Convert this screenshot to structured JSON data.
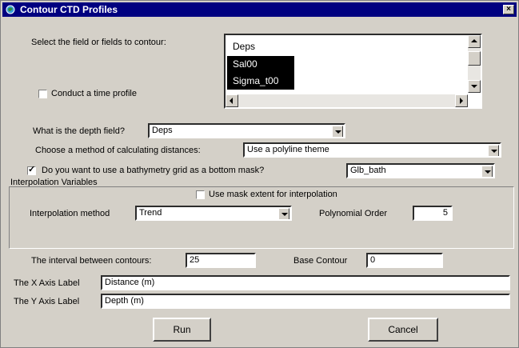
{
  "window": {
    "title": "Contour CTD Profiles",
    "close_label": "×"
  },
  "fields": {
    "label": "Select the field or fields to contour:",
    "items": [
      {
        "label": "Deps",
        "selected": false
      },
      {
        "label": "Sal00",
        "selected": true
      },
      {
        "label": "Sigma_t00",
        "selected": true
      }
    ]
  },
  "time_profile": {
    "label": "Conduct a time profile",
    "checked": false
  },
  "depth_field": {
    "label": "What is the depth field?",
    "value": "Deps"
  },
  "distance_method": {
    "label": "Choose a method of calculating distances:",
    "value": "Use a polyline theme"
  },
  "bathymetry": {
    "label": "Do you want to use a bathymetry grid as a bottom mask?",
    "checked": true,
    "value": "Glb_bath"
  },
  "interpolation": {
    "group_label": "Interpolation Variables",
    "mask_extent_label": "Use mask extent for interpolation",
    "mask_extent_checked": false,
    "method_label": "Interpolation method",
    "method_value": "Trend",
    "poly_label": "Polynomial Order",
    "poly_value": "5"
  },
  "contours": {
    "interval_label": "The interval between contours:",
    "interval_value": "25",
    "base_label": "Base Contour",
    "base_value": "0"
  },
  "x_axis": {
    "label": "The X Axis Label",
    "value": "Distance (m)"
  },
  "y_axis": {
    "label": "The Y Axis Label",
    "value": "Depth (m)"
  },
  "buttons": {
    "run": "Run",
    "cancel": "Cancel"
  }
}
